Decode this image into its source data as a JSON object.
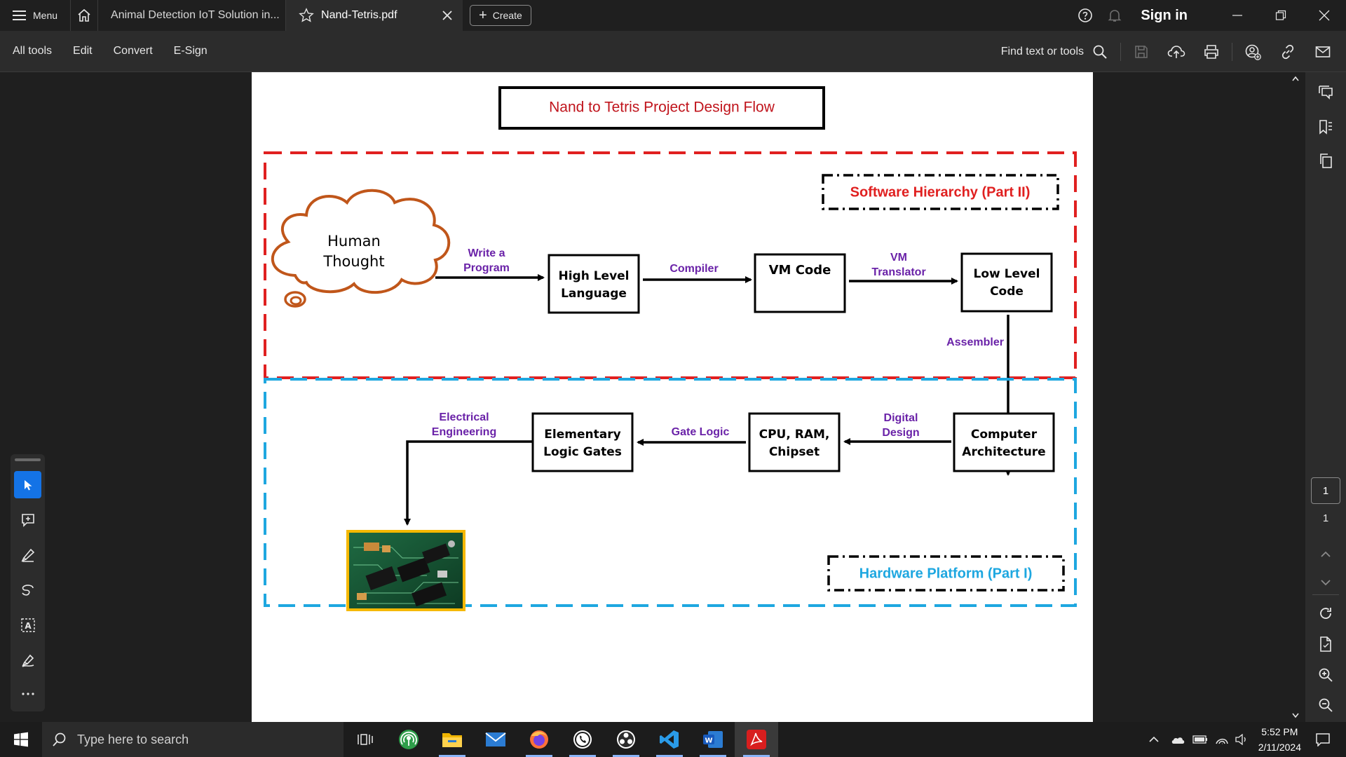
{
  "titlebar": {
    "menu_label": "Menu",
    "tabs": [
      {
        "label": "Animal Detection IoT Solution in..."
      },
      {
        "label": "Nand-Tetris.pdf"
      }
    ],
    "create_label": "Create",
    "signin_label": "Sign in"
  },
  "toolbar": {
    "items": [
      "All tools",
      "Edit",
      "Convert",
      "E-Sign"
    ],
    "find_label": "Find text or tools"
  },
  "document": {
    "title": "Nand to Tetris Project Design Flow",
    "software_label": "Software Hierarchy (Part II)",
    "hardware_label": "Hardware Platform (Part I)",
    "cloud_text": [
      "Human",
      "Thought"
    ],
    "boxes": {
      "high_level": [
        "High Level",
        "Language"
      ],
      "vm_code": [
        "VM Code"
      ],
      "low_level": [
        "Low Level",
        "Code"
      ],
      "computer_arch": [
        "Computer",
        "Architecture"
      ],
      "cpu": [
        "CPU, RAM,",
        "Chipset"
      ],
      "gates": [
        "Elementary",
        "Logic Gates"
      ]
    },
    "arrow_labels": {
      "write_program": [
        "Write a",
        "Program"
      ],
      "compiler": [
        "Compiler"
      ],
      "vm_translator": [
        "VM",
        "Translator"
      ],
      "assembler": [
        "Assembler"
      ],
      "digital_design": [
        "Digital",
        "Design"
      ],
      "gate_logic": [
        "Gate Logic"
      ],
      "electrical": [
        "Electrical",
        "Engineering"
      ]
    },
    "colors": {
      "red": "#e02020",
      "blue": "#1ea7e0",
      "purple": "#6a22a8",
      "title_red": "#c0141c",
      "cloud": "#c0561a",
      "image_border": "#f5b800"
    }
  },
  "navigation": {
    "current_page": "1",
    "total_pages": "1"
  },
  "taskbar": {
    "search_placeholder": "Type here to search",
    "time": "5:52 PM",
    "date": "2/11/2024"
  }
}
